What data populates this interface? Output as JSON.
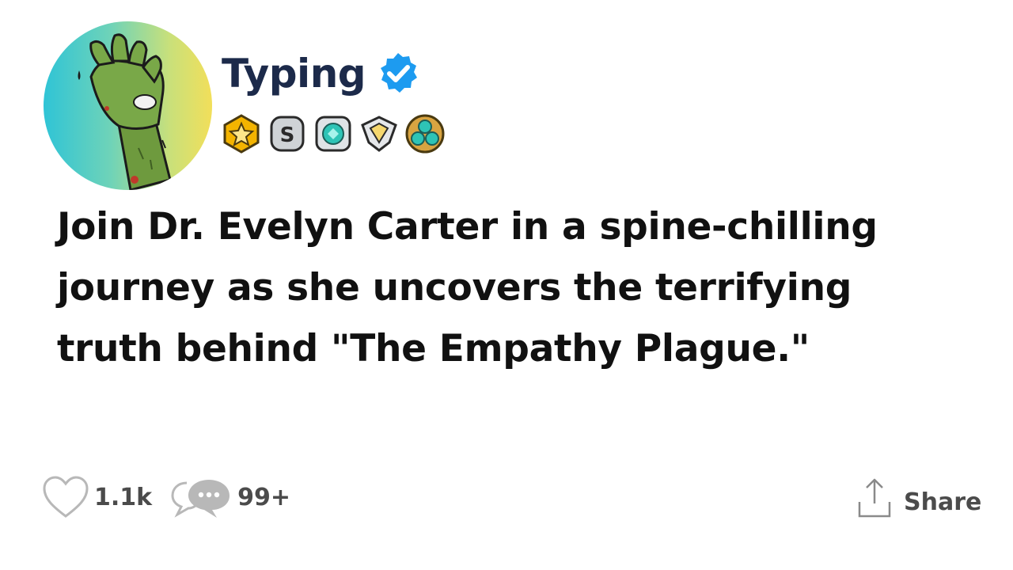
{
  "post": {
    "author": {
      "username": "Typing",
      "verified": true,
      "avatar_icon": "zombie-hand-icon",
      "verified_icon": "verified-badge-icon"
    },
    "badges": [
      {
        "icon": "star-badge-icon"
      },
      {
        "icon": "s-badge-icon"
      },
      {
        "icon": "gem-badge-icon"
      },
      {
        "icon": "diamond-shield-badge-icon"
      },
      {
        "icon": "triple-gem-badge-icon"
      }
    ],
    "headline": "Join Dr. Evelyn Carter in a spine-chilling journey as she uncovers the terrifying truth behind \"The Empathy Plague.\""
  },
  "actions": {
    "likes": {
      "count": "1.1k",
      "icon": "heart-icon"
    },
    "comments": {
      "count": "99+",
      "icon": "comment-bubbles-icon"
    },
    "share": {
      "label": "Share",
      "icon": "share-icon"
    }
  },
  "colors": {
    "username": "#1c2a4a",
    "verified": "#1d9bf0",
    "headline": "#111111",
    "action_text": "#4b4b4b"
  }
}
